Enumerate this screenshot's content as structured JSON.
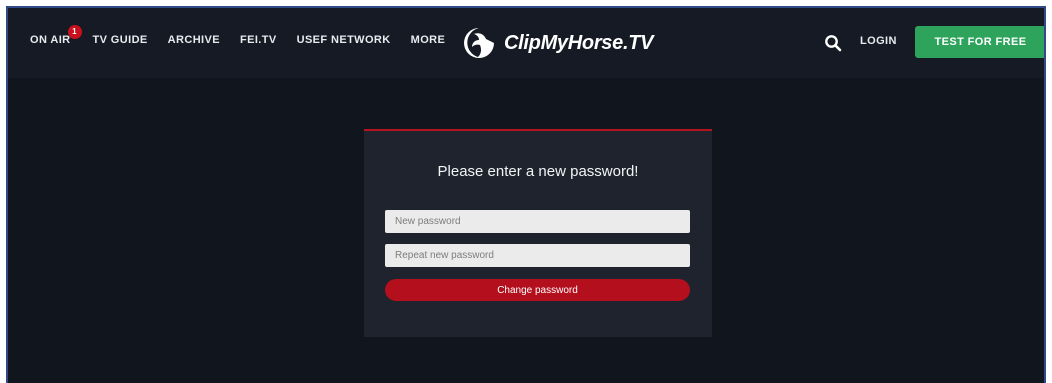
{
  "nav": {
    "items": [
      {
        "label": "ON AIR",
        "badge": "1"
      },
      {
        "label": "TV GUIDE"
      },
      {
        "label": "ARCHIVE"
      },
      {
        "label": "FEI.TV"
      },
      {
        "label": "USEF NETWORK"
      },
      {
        "label": "MORE"
      }
    ]
  },
  "brand": {
    "name": "ClipMyHorse.TV",
    "icon": "horse-head-logo-icon"
  },
  "header": {
    "search_icon": "search-icon",
    "login_label": "LOGIN",
    "cta_label": "TEST FOR FREE"
  },
  "form": {
    "title": "Please enter a new password!",
    "new_password_placeholder": "New password",
    "repeat_password_placeholder": "Repeat new password",
    "submit_label": "Change password"
  },
  "colors": {
    "background": "#11151e",
    "card": "#1e232d",
    "accent_red": "#b30f1c",
    "cta_green": "#2ea35c"
  }
}
